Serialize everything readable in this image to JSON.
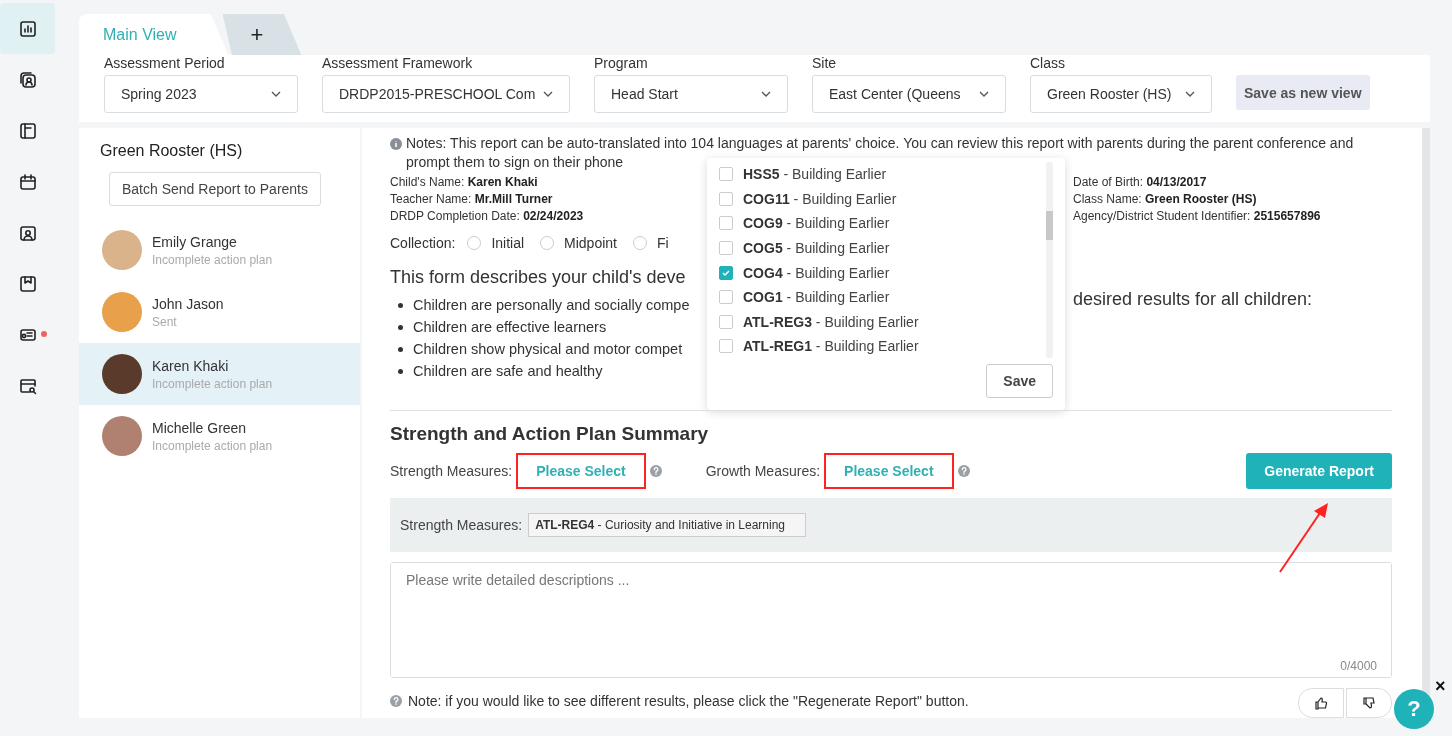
{
  "nav": [
    {
      "selected": true,
      "notified": false
    },
    {
      "selected": false,
      "notified": false
    },
    {
      "selected": false,
      "notified": false
    },
    {
      "selected": false,
      "notified": false
    },
    {
      "selected": false,
      "notified": false
    },
    {
      "selected": false,
      "notified": false
    },
    {
      "selected": false,
      "notified": true
    },
    {
      "selected": false,
      "notified": false
    }
  ],
  "tabs": [
    {
      "label": "Main View",
      "selected": true
    },
    {
      "label": "+",
      "selected": false
    }
  ],
  "filters": [
    {
      "label": "Assessment Period",
      "value": "Spring 2023"
    },
    {
      "label": "Assessment Framework",
      "value": "DRDP2015-PRESCHOOL Com"
    },
    {
      "label": "Program",
      "value": "Head Start"
    },
    {
      "label": "Site",
      "value": "East Center (Queens"
    },
    {
      "label": "Class",
      "value": "Green Rooster (HS)"
    }
  ],
  "save_view_button": "Save as new view",
  "student_list": {
    "title": "Green Rooster (HS)",
    "batch_button": "Batch Send Report to Parents",
    "students": [
      {
        "name": "Emily Grange",
        "status": "Incomplete action plan",
        "selected": false,
        "color": "#d9b48a"
      },
      {
        "name": "John Jason",
        "status": "Sent",
        "selected": false,
        "color": "#e8a04a"
      },
      {
        "name": "Karen Khaki",
        "status": "Incomplete action plan",
        "selected": true,
        "color": "#5a3a2a"
      },
      {
        "name": "Michelle Green",
        "status": "Incomplete action plan",
        "selected": false,
        "color": "#b08070"
      }
    ]
  },
  "report": {
    "notes": "Notes: This report can be auto-translated into 104 languages at parents' choice. You can review this report with parents during the parent conference and prompt them to sign on their phone",
    "info_left": [
      {
        "label": "Child's Name:",
        "value": "Karen Khaki"
      },
      {
        "label": "Teacher Name:",
        "value": "Mr.Mill Turner"
      },
      {
        "label": "DRDP Completion Date:",
        "value": "02/24/2023"
      }
    ],
    "info_right": [
      {
        "label": "Date of Birth:",
        "value": "04/13/2017"
      },
      {
        "label": "Class Name:",
        "value": "Green Rooster (HS)"
      },
      {
        "label": "Agency/District Student Identifier:",
        "value": "2515657896"
      }
    ],
    "collection": {
      "label": "Collection:",
      "options": [
        {
          "label": "Initial",
          "selected": false
        },
        {
          "label": "Midpoint",
          "selected": false
        },
        {
          "label": "Fi",
          "selected": false
        }
      ]
    },
    "intro_left": "This form describes your child's deve",
    "intro_right": "desired results for all children:",
    "bullets": [
      "Children are personally and socially compe",
      "Children are effective learners",
      "Children show physical and motor compet",
      "Children are safe and healthy"
    ],
    "summary_title": "Strength and Action Plan Summary",
    "strength_label": "Strength Measures:",
    "strength_button": "Please Select",
    "growth_label": "Growth Measures:",
    "growth_button": "Please Select",
    "generate_button": "Generate Report",
    "selected_label": "Strength Measures:",
    "selected_code": "ATL-REG4",
    "selected_text": "- Curiosity and Initiative in Learning",
    "description": {
      "placeholder": "Please write detailed descriptions ...",
      "counter": "0/4000"
    },
    "note": "Note: if you would like to see different results, please click the \"Regenerate Report\" button."
  },
  "measure_popup": {
    "items": [
      {
        "code": "HSS5",
        "text": "- Building Earlier",
        "checked": false
      },
      {
        "code": "COG11",
        "text": "- Building Earlier",
        "checked": false
      },
      {
        "code": "COG9",
        "text": "- Building Earlier",
        "checked": false
      },
      {
        "code": "COG5",
        "text": "- Building Earlier",
        "checked": false
      },
      {
        "code": "COG4",
        "text": "- Building Earlier",
        "checked": true
      },
      {
        "code": "COG1",
        "text": "- Building Earlier",
        "checked": false
      },
      {
        "code": "ATL-REG3",
        "text": "- Building Earlier",
        "checked": false
      },
      {
        "code": "ATL-REG1",
        "text": "- Building Earlier",
        "checked": false
      }
    ],
    "save_button": "Save"
  },
  "help_button": "?",
  "close_mark": "×"
}
